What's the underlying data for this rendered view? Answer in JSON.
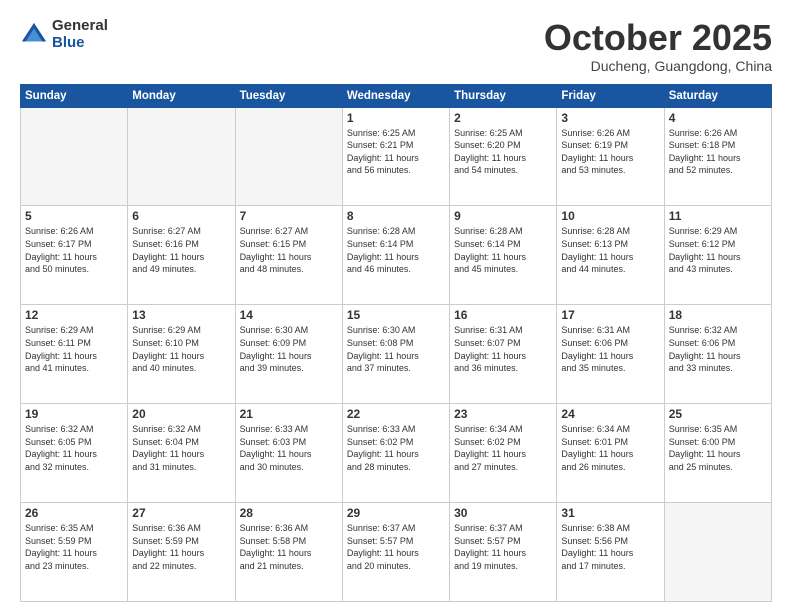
{
  "header": {
    "logo_general": "General",
    "logo_blue": "Blue",
    "month_title": "October 2025",
    "location": "Ducheng, Guangdong, China"
  },
  "weekdays": [
    "Sunday",
    "Monday",
    "Tuesday",
    "Wednesday",
    "Thursday",
    "Friday",
    "Saturday"
  ],
  "weeks": [
    [
      {
        "day": "",
        "info": ""
      },
      {
        "day": "",
        "info": ""
      },
      {
        "day": "",
        "info": ""
      },
      {
        "day": "1",
        "info": "Sunrise: 6:25 AM\nSunset: 6:21 PM\nDaylight: 11 hours\nand 56 minutes."
      },
      {
        "day": "2",
        "info": "Sunrise: 6:25 AM\nSunset: 6:20 PM\nDaylight: 11 hours\nand 54 minutes."
      },
      {
        "day": "3",
        "info": "Sunrise: 6:26 AM\nSunset: 6:19 PM\nDaylight: 11 hours\nand 53 minutes."
      },
      {
        "day": "4",
        "info": "Sunrise: 6:26 AM\nSunset: 6:18 PM\nDaylight: 11 hours\nand 52 minutes."
      }
    ],
    [
      {
        "day": "5",
        "info": "Sunrise: 6:26 AM\nSunset: 6:17 PM\nDaylight: 11 hours\nand 50 minutes."
      },
      {
        "day": "6",
        "info": "Sunrise: 6:27 AM\nSunset: 6:16 PM\nDaylight: 11 hours\nand 49 minutes."
      },
      {
        "day": "7",
        "info": "Sunrise: 6:27 AM\nSunset: 6:15 PM\nDaylight: 11 hours\nand 48 minutes."
      },
      {
        "day": "8",
        "info": "Sunrise: 6:28 AM\nSunset: 6:14 PM\nDaylight: 11 hours\nand 46 minutes."
      },
      {
        "day": "9",
        "info": "Sunrise: 6:28 AM\nSunset: 6:14 PM\nDaylight: 11 hours\nand 45 minutes."
      },
      {
        "day": "10",
        "info": "Sunrise: 6:28 AM\nSunset: 6:13 PM\nDaylight: 11 hours\nand 44 minutes."
      },
      {
        "day": "11",
        "info": "Sunrise: 6:29 AM\nSunset: 6:12 PM\nDaylight: 11 hours\nand 43 minutes."
      }
    ],
    [
      {
        "day": "12",
        "info": "Sunrise: 6:29 AM\nSunset: 6:11 PM\nDaylight: 11 hours\nand 41 minutes."
      },
      {
        "day": "13",
        "info": "Sunrise: 6:29 AM\nSunset: 6:10 PM\nDaylight: 11 hours\nand 40 minutes."
      },
      {
        "day": "14",
        "info": "Sunrise: 6:30 AM\nSunset: 6:09 PM\nDaylight: 11 hours\nand 39 minutes."
      },
      {
        "day": "15",
        "info": "Sunrise: 6:30 AM\nSunset: 6:08 PM\nDaylight: 11 hours\nand 37 minutes."
      },
      {
        "day": "16",
        "info": "Sunrise: 6:31 AM\nSunset: 6:07 PM\nDaylight: 11 hours\nand 36 minutes."
      },
      {
        "day": "17",
        "info": "Sunrise: 6:31 AM\nSunset: 6:06 PM\nDaylight: 11 hours\nand 35 minutes."
      },
      {
        "day": "18",
        "info": "Sunrise: 6:32 AM\nSunset: 6:06 PM\nDaylight: 11 hours\nand 33 minutes."
      }
    ],
    [
      {
        "day": "19",
        "info": "Sunrise: 6:32 AM\nSunset: 6:05 PM\nDaylight: 11 hours\nand 32 minutes."
      },
      {
        "day": "20",
        "info": "Sunrise: 6:32 AM\nSunset: 6:04 PM\nDaylight: 11 hours\nand 31 minutes."
      },
      {
        "day": "21",
        "info": "Sunrise: 6:33 AM\nSunset: 6:03 PM\nDaylight: 11 hours\nand 30 minutes."
      },
      {
        "day": "22",
        "info": "Sunrise: 6:33 AM\nSunset: 6:02 PM\nDaylight: 11 hours\nand 28 minutes."
      },
      {
        "day": "23",
        "info": "Sunrise: 6:34 AM\nSunset: 6:02 PM\nDaylight: 11 hours\nand 27 minutes."
      },
      {
        "day": "24",
        "info": "Sunrise: 6:34 AM\nSunset: 6:01 PM\nDaylight: 11 hours\nand 26 minutes."
      },
      {
        "day": "25",
        "info": "Sunrise: 6:35 AM\nSunset: 6:00 PM\nDaylight: 11 hours\nand 25 minutes."
      }
    ],
    [
      {
        "day": "26",
        "info": "Sunrise: 6:35 AM\nSunset: 5:59 PM\nDaylight: 11 hours\nand 23 minutes."
      },
      {
        "day": "27",
        "info": "Sunrise: 6:36 AM\nSunset: 5:59 PM\nDaylight: 11 hours\nand 22 minutes."
      },
      {
        "day": "28",
        "info": "Sunrise: 6:36 AM\nSunset: 5:58 PM\nDaylight: 11 hours\nand 21 minutes."
      },
      {
        "day": "29",
        "info": "Sunrise: 6:37 AM\nSunset: 5:57 PM\nDaylight: 11 hours\nand 20 minutes."
      },
      {
        "day": "30",
        "info": "Sunrise: 6:37 AM\nSunset: 5:57 PM\nDaylight: 11 hours\nand 19 minutes."
      },
      {
        "day": "31",
        "info": "Sunrise: 6:38 AM\nSunset: 5:56 PM\nDaylight: 11 hours\nand 17 minutes."
      },
      {
        "day": "",
        "info": ""
      }
    ]
  ]
}
